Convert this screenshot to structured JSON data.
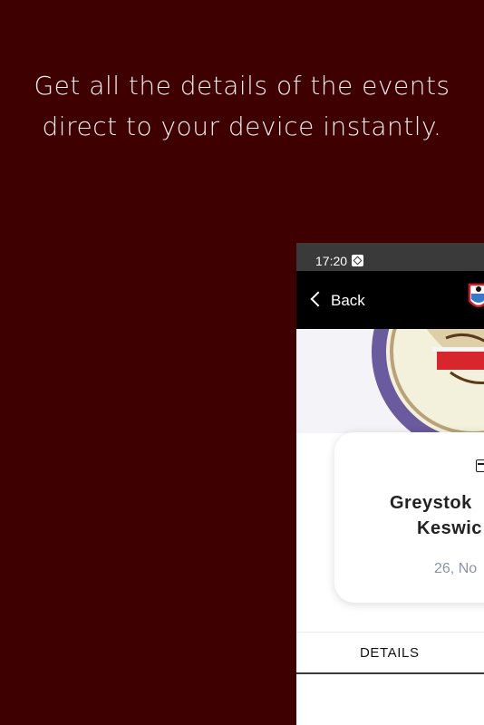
{
  "headline": {
    "line1": "Get all the details of the events",
    "line2": "direct to your device instantly."
  },
  "status_bar": {
    "time": "17:20"
  },
  "nav": {
    "back_label": "Back"
  },
  "event": {
    "home_team": "Greystok",
    "away_team": "Keswic",
    "date": "26, No"
  },
  "tabs": [
    {
      "label": "DETAILS"
    }
  ],
  "colors": {
    "background": "#3e0001",
    "headline_text": "#f3ecec",
    "nav_bar": "#000000",
    "status_bar": "#3a3a3a",
    "date_text": "#8a94a6"
  }
}
